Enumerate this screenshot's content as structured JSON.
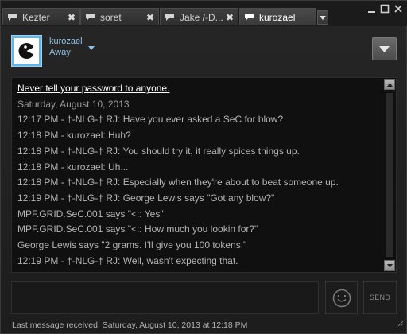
{
  "tabs": [
    {
      "label": "Kezter",
      "active": false
    },
    {
      "label": "soret",
      "active": false
    },
    {
      "label": "Jake /-D...",
      "active": false
    },
    {
      "label": "kurozael",
      "active": true
    }
  ],
  "tab_close_glyph": "✖",
  "window_controls": {
    "minimize_icon": "minimize-icon",
    "maximize_icon": "maximize-icon",
    "close_icon": "close-icon"
  },
  "header": {
    "username": "kurozael",
    "status": "Away"
  },
  "chat": {
    "lines": [
      {
        "kind": "warn",
        "text": "Never tell your password to anyone."
      },
      {
        "kind": "date",
        "text": "Saturday, August 10, 2013"
      },
      {
        "kind": "msg",
        "text": "12:17 PM - †-NLG-† RJ: Have you ever asked a SeC for blow?"
      },
      {
        "kind": "msg",
        "text": "12:18 PM - kurozael: Huh?"
      },
      {
        "kind": "msg",
        "text": "12:18 PM - †-NLG-† RJ: You should try it, it really spices things up."
      },
      {
        "kind": "msg",
        "text": "12:18 PM - kurozael: Uh..."
      },
      {
        "kind": "msg",
        "text": "12:18 PM - †-NLG-† RJ: Especially when they're about to beat someone up."
      },
      {
        "kind": "msg",
        "text": "12:19 PM - †-NLG-† RJ: George Lewis says \"Got any blow?\""
      },
      {
        "kind": "msg",
        "text": "MPF.GRID.SeC.001 says \"<:: Yes\""
      },
      {
        "kind": "msg",
        "text": "MPF.GRID.SeC.001 says \"<:: How much you lookin for?\""
      },
      {
        "kind": "msg",
        "text": "George Lewis says \"2 grams. I'll give you 100 tokens.\""
      },
      {
        "kind": "msg",
        "text": "12:19 PM - †-NLG-† RJ: Well, wasn't expecting that."
      }
    ]
  },
  "compose": {
    "value": "",
    "send_label": "SEND"
  },
  "footer": {
    "last_received": "Last message received: Saturday, August 10, 2013 at 12:18 PM"
  },
  "colors": {
    "accent_text": "#8fc3e8",
    "avatar_border": "#6bb1e0",
    "background": "#1d1d1d",
    "chat_background": "#101010"
  }
}
